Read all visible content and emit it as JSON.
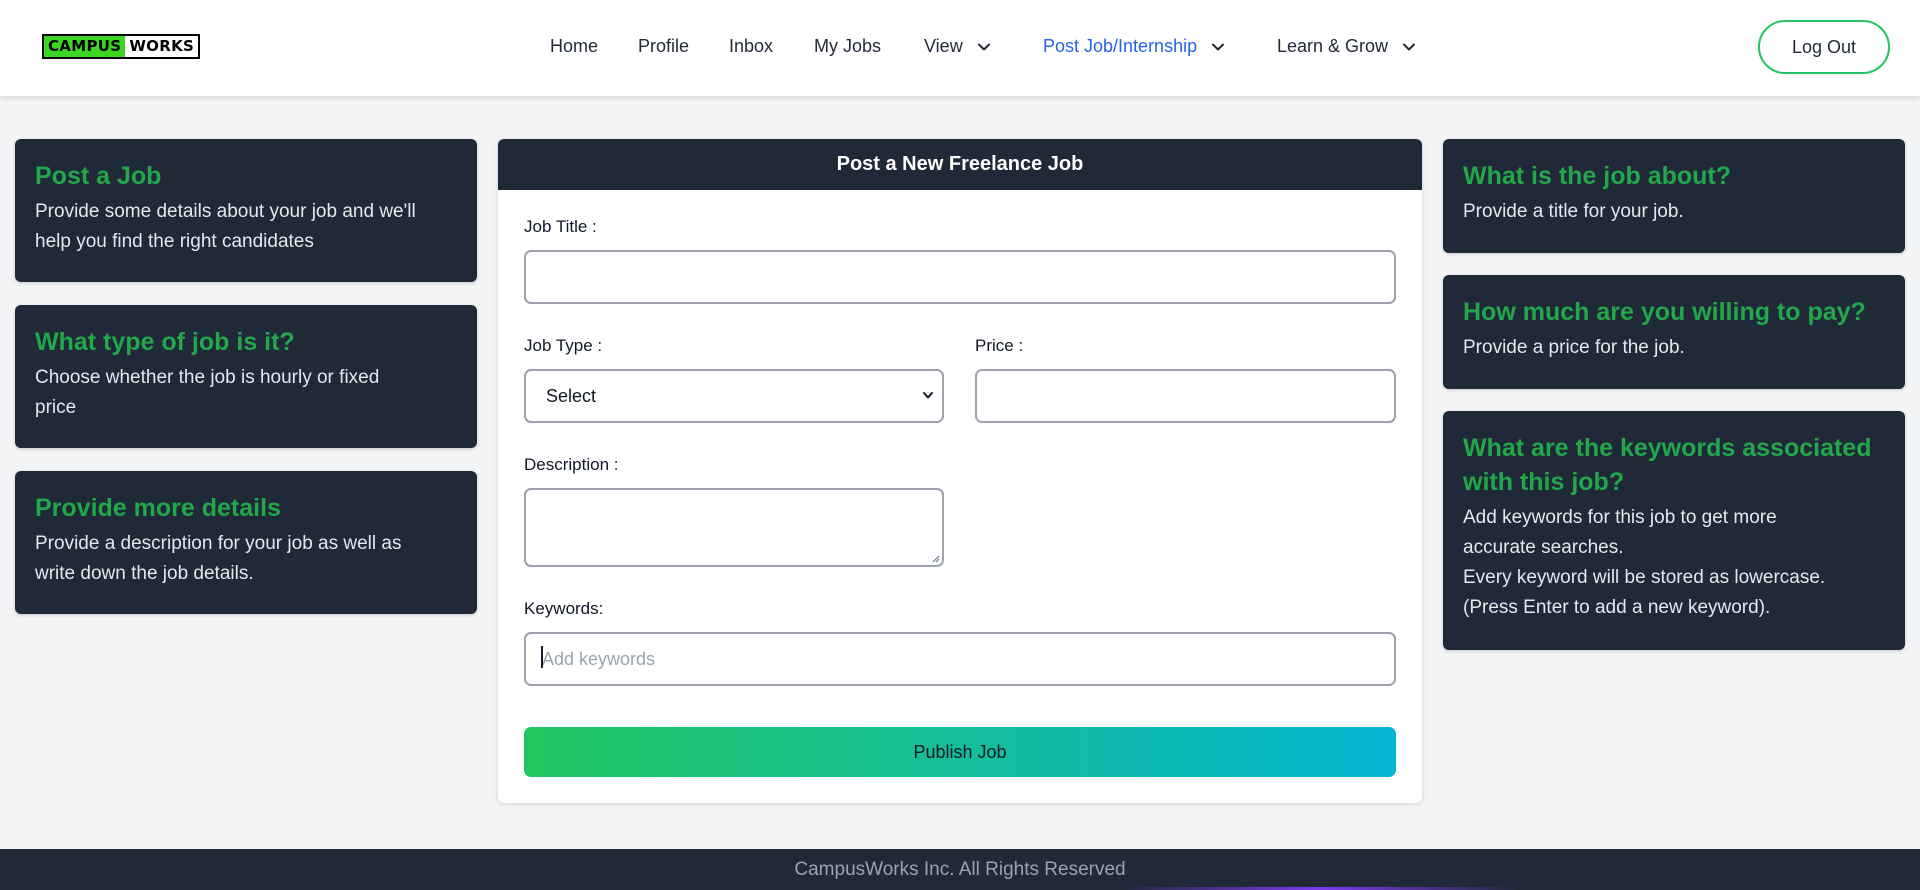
{
  "header": {
    "logo": {
      "part1": "CAMPUS",
      "part2": "WORKS"
    },
    "nav": [
      {
        "label": "Home"
      },
      {
        "label": "Profile"
      },
      {
        "label": "Inbox"
      },
      {
        "label": "My Jobs"
      },
      {
        "label": "View",
        "icon": "chevron-down-icon"
      },
      {
        "label": "Post Job/Internship",
        "icon": "chevron-down-icon",
        "active": true
      },
      {
        "label": "Learn & Grow",
        "icon": "chevron-down-icon"
      }
    ],
    "logout_label": "Log Out"
  },
  "left_cards": [
    {
      "title": "Post a Job",
      "text": "Provide some details about your job and we'll\nhelp you find the right candidates"
    },
    {
      "title": "What type of job is it?",
      "text": "Choose whether the job is hourly or fixed\nprice"
    },
    {
      "title": "Provide more details",
      "text": "Provide a description for your job as well as\nwrite down the job details."
    }
  ],
  "right_cards": [
    {
      "title": "What is the job about?",
      "text": "Provide a title for your job."
    },
    {
      "title": "How much are you willing to pay?",
      "text": "Provide a price for the job."
    },
    {
      "title": "What are the keywords associated\nwith this job?",
      "text": "Add keywords for this job to get more\naccurate searches.\nEvery keyword will be stored as lowercase.\n(Press Enter to add a new keyword)."
    }
  ],
  "form": {
    "heading": "Post a New Freelance Job",
    "job_title_label": "Job Title :",
    "job_title_value": "",
    "job_type_label": "Job Type :",
    "job_type_selected": "Select",
    "price_label": "Price :",
    "price_value": "",
    "description_label": "Description :",
    "description_value": "",
    "keywords_label": "Keywords:",
    "keywords_placeholder": "Add keywords",
    "publish_label": "Publish Job"
  },
  "footer": {
    "text": "CampusWorks Inc. All Rights Reserved"
  },
  "colors": {
    "brand_green": "#22a74a",
    "nav_active": "#2563eb",
    "dark_card": "#1f2937",
    "publish_gradient_start": "#22c55e",
    "publish_gradient_end": "#06b6d4"
  }
}
